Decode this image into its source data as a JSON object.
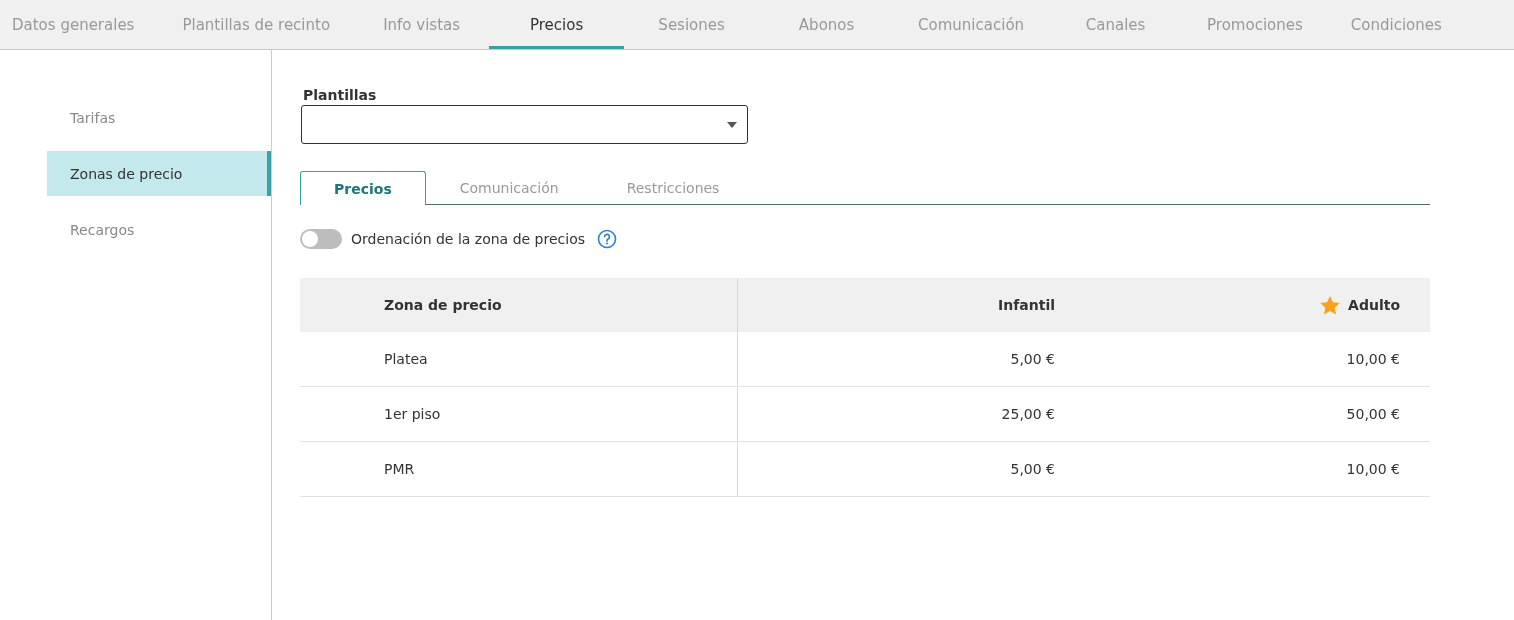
{
  "top_tabs": [
    {
      "label": "Datos generales",
      "selected": false
    },
    {
      "label": "Plantillas de recinto",
      "selected": false
    },
    {
      "label": "Info vistas",
      "selected": false
    },
    {
      "label": "Precios",
      "selected": true
    },
    {
      "label": "Sesiones",
      "selected": false
    },
    {
      "label": "Abonos",
      "selected": false
    },
    {
      "label": "Comunicación",
      "selected": false
    },
    {
      "label": "Canales",
      "selected": false
    },
    {
      "label": "Promociones",
      "selected": false
    },
    {
      "label": "Condiciones",
      "selected": false
    }
  ],
  "sidebar": {
    "items": [
      {
        "label": "Tarifas",
        "selected": false
      },
      {
        "label": "Zonas de precio",
        "selected": true
      },
      {
        "label": "Recargos",
        "selected": false
      }
    ]
  },
  "templates_select": {
    "label": "Plantillas"
  },
  "sub_tabs": [
    {
      "label": "Precios",
      "selected": true
    },
    {
      "label": "Comunicación",
      "selected": false
    },
    {
      "label": "Restricciones",
      "selected": false
    }
  ],
  "sort_toggle": {
    "label": "Ordenación de la zona de precios",
    "on": false
  },
  "table": {
    "columns": [
      {
        "label": "Zona de precio",
        "starred": false
      },
      {
        "label": "Infantil",
        "starred": false
      },
      {
        "label": "Adulto",
        "starred": true
      }
    ],
    "rows": [
      [
        "Platea",
        "5,00 €",
        "10,00 €"
      ],
      [
        "1er piso",
        "25,00 €",
        "50,00 €"
      ],
      [
        "PMR",
        "5,00 €",
        "10,00 €"
      ]
    ]
  }
}
